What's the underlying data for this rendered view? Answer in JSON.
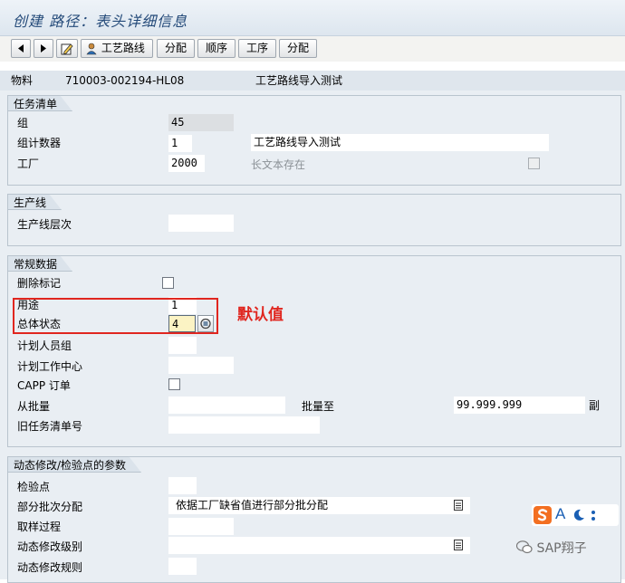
{
  "window": {
    "title": "创建 路径：表头详细信息"
  },
  "toolbar": {
    "buttons": [
      {
        "label": "工艺路线"
      },
      {
        "label": "分配"
      },
      {
        "label": "顺序"
      },
      {
        "label": "工序"
      },
      {
        "label": "分配"
      }
    ]
  },
  "header": {
    "material_label": "物料",
    "material_value": "710003-002194-HL08",
    "material_desc": "工艺路线导入测试"
  },
  "task_list": {
    "title": "任务清单",
    "group_label": "组",
    "group_value": "45",
    "counter_label": "组计数器",
    "counter_value": "1",
    "counter_desc": "工艺路线导入测试",
    "plant_label": "工厂",
    "plant_value": "2000",
    "longtext_label": "长文本存在"
  },
  "production_line": {
    "title": "生产线",
    "level_label": "生产线层次",
    "level_value": ""
  },
  "general_data": {
    "title": "常规数据",
    "deletion_flag_label": "删除标记",
    "usage_label": "用途",
    "usage_value": "1",
    "status_label": "总体状态",
    "status_value": "4",
    "planner_group_label": "计划人员组",
    "planner_group_value": "",
    "work_center_label": "计划工作中心",
    "work_center_value": "",
    "capp_label": "CAPP 订单",
    "from_lot_label": "从批量",
    "from_lot_value": "",
    "to_lot_label": "批量至",
    "to_lot_value": "99.999.999",
    "unit_value": "副",
    "old_task_label": "旧任务清单号",
    "old_task_value": ""
  },
  "dynamic": {
    "title": "动态修改/检验点的参数",
    "inspection_point_label": "检验点",
    "partial_lot_label": "部分批次分配",
    "partial_lot_value": "依据工厂缺省值进行部分批分配",
    "sampling_label": "取样过程",
    "modification_level_label": "动态修改级别",
    "modification_rule_label": "动态修改规则"
  },
  "annotation": {
    "text": "默认值"
  },
  "ime": {
    "letter": "A"
  },
  "watermark": {
    "text": "SAP翔子"
  },
  "colors": {
    "title_text": "#244a79",
    "panel_bg": "#e9eef3",
    "annotation_red": "#e0261f",
    "sogou_orange": "#f36f21"
  }
}
